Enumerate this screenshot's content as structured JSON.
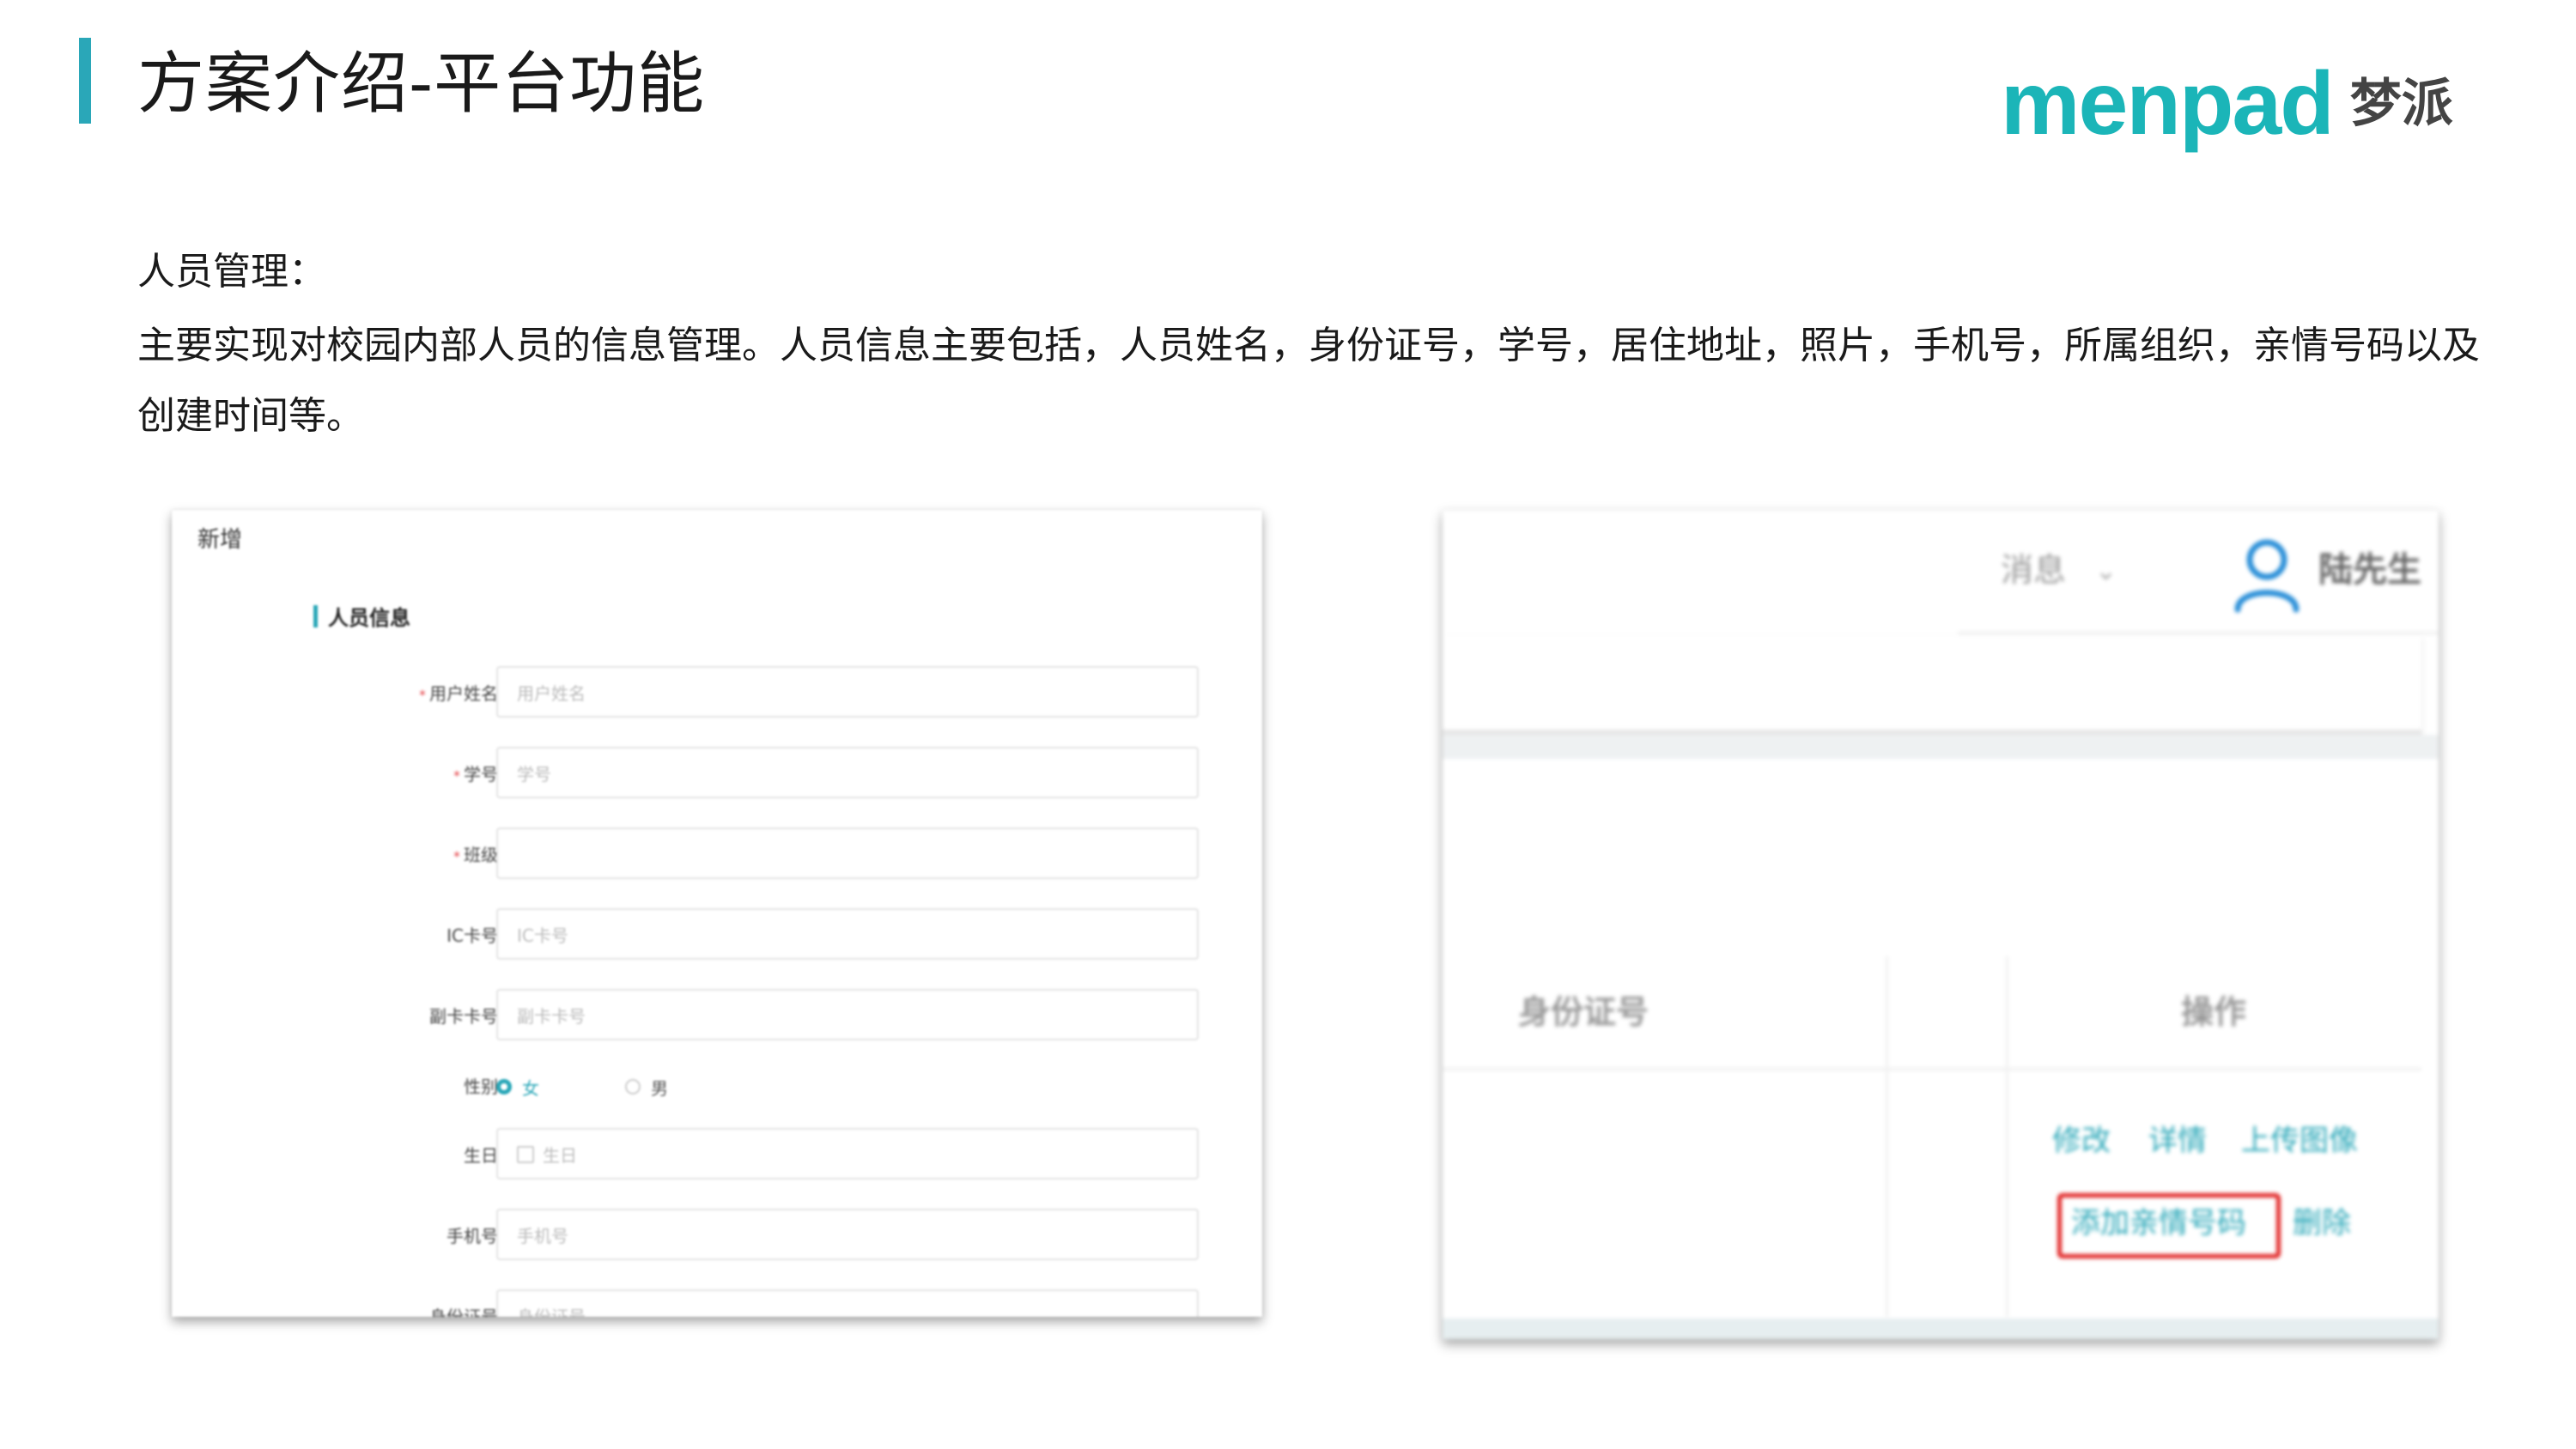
{
  "slide": {
    "title": "方案介绍-平台功能",
    "logo_text": "menpad",
    "logo_cn": "梦派",
    "section_label": "人员管理：",
    "section_desc": "主要实现对校园内部人员的信息管理。人员信息主要包括，人员姓名，身份证号，学号，居住地址，照片，手机号，所属组织，亲情号码以及创建时间等。",
    "accent_color": "#2aa7b8"
  },
  "form": {
    "title": "新增",
    "section_title": "人员信息",
    "fields": [
      {
        "label": "用户姓名",
        "required": true,
        "placeholder": "用户姓名"
      },
      {
        "label": "学号",
        "required": true,
        "placeholder": "学号"
      },
      {
        "label": "班级",
        "required": true,
        "placeholder": ""
      },
      {
        "label": "IC卡号",
        "required": false,
        "placeholder": "IC卡号"
      },
      {
        "label": "副卡卡号",
        "required": false,
        "placeholder": "副卡卡号"
      },
      {
        "label": "性别",
        "required": false,
        "options": [
          "女",
          "男"
        ],
        "selected": "女"
      },
      {
        "label": "生日",
        "required": false,
        "placeholder": "生日"
      },
      {
        "label": "手机号",
        "required": false,
        "placeholder": "手机号"
      },
      {
        "label": "身份证号",
        "required": false,
        "placeholder": "身份证号"
      }
    ]
  },
  "table": {
    "header_message": "消息",
    "user_name": "陆先生",
    "columns": [
      "身份证号",
      "操作"
    ],
    "actions": [
      "修改",
      "详情",
      "上传图像",
      "添加亲情号码",
      "删除"
    ],
    "highlighted_action": "添加亲情号码",
    "highlight_color": "#e02020"
  }
}
